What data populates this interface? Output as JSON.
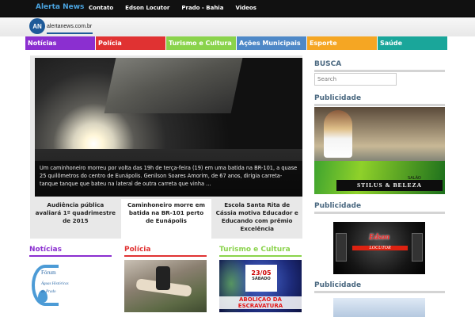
{
  "topbar": {
    "brand": "Alerta News",
    "nav": [
      "Contato",
      "Edson Locutor",
      "Prado - Bahia",
      "Videos"
    ]
  },
  "logo": {
    "mark": "AN",
    "text": "alertanews.com.br"
  },
  "categories": [
    {
      "label": "Notícias",
      "color": "#8b2fd0"
    },
    {
      "label": "Polícia",
      "color": "#e03232"
    },
    {
      "label": "Turismo e Cultura",
      "color": "#8ad34b"
    },
    {
      "label": "Ações Municipais",
      "color": "#4e88c7"
    },
    {
      "label": "Esporte",
      "color": "#f5a623"
    },
    {
      "label": "Saúde",
      "color": "#1aa69a"
    }
  ],
  "slider": {
    "caption": "Um caminhoneiro morreu por volta das 19h de terça-feira (19) em uma batida na BR-101, a quase 25 quilômetros do centro de Eunápolis. Genilson Soares Amorim, de 67 anos, dirigia carreta-tanque tanque que bateu na lateral de outra carreta que vinha ...",
    "thumbs": [
      "Audiência pública avaliará 1º quadrimestre de 2015",
      "Caminhoneiro morre em batida na BR-101 perto de Eunápolis",
      "Escola Santa Rita de Cássia motiva Educador e Educando com prêmio Excelência"
    ]
  },
  "sections": {
    "noticias": {
      "title": "Notícias",
      "color": "#8b2fd0"
    },
    "policia": {
      "title": "Polícia",
      "color": "#e03232"
    },
    "turismo": {
      "title": "Turismo e Cultura",
      "color": "#8ad34b"
    }
  },
  "forum_logo": {
    "t1": "Fórum",
    "t2": "Águas Históricas",
    "t3": "de Prado"
  },
  "event_poster": {
    "date": "23/05",
    "day": "SÁBADO",
    "title": "ABOLIÇÃO DA ESCRAVATURA"
  },
  "sidebar": {
    "busca_title": "BUSCA",
    "search_placeholder": "Search",
    "publicidade": "Publicidade"
  },
  "ad_salon": {
    "brand": "STILUS & BELEZA",
    "sub": "SALÃO"
  },
  "ad_locutor": {
    "name": "Edson",
    "sub": "LOCUTOR"
  }
}
